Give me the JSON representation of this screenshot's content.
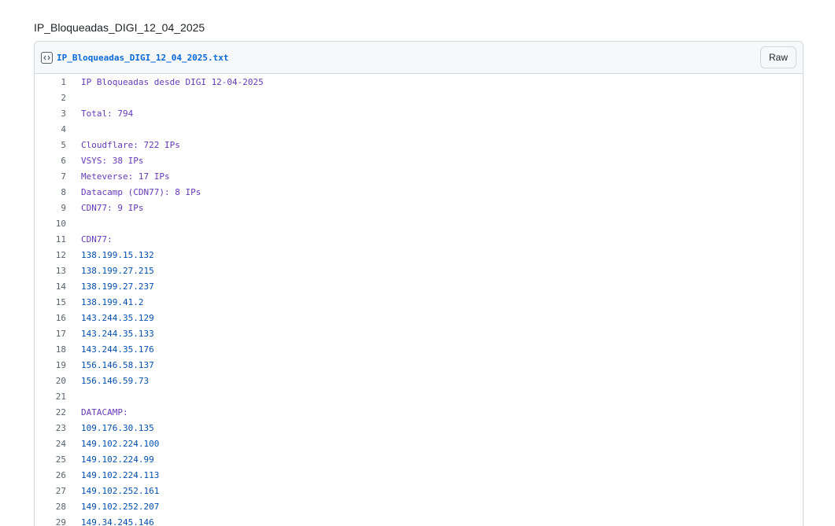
{
  "gist": {
    "title": "IP_Bloqueadas_DIGI_12_04_2025"
  },
  "file": {
    "name": "IP_Bloqueadas_DIGI_12_04_2025.txt",
    "icon": "code-square-icon",
    "raw_label": "Raw"
  },
  "colors": {
    "link": "#0969da",
    "text_line": "#6639ba",
    "ip_line": "#0550ae",
    "line_number": "#59636e",
    "border": "#d0d7de"
  },
  "lines": [
    {
      "n": "1",
      "text": "IP Bloqueadas desde DIGI 12-04-2025",
      "kind": "text"
    },
    {
      "n": "2",
      "text": "",
      "kind": "text"
    },
    {
      "n": "3",
      "text": "Total: 794",
      "kind": "text"
    },
    {
      "n": "4",
      "text": "",
      "kind": "text"
    },
    {
      "n": "5",
      "text": "Cloudflare: 722 IPs",
      "kind": "text"
    },
    {
      "n": "6",
      "text": "VSYS: 38 IPs",
      "kind": "text"
    },
    {
      "n": "7",
      "text": "Meteverse: 17 IPs",
      "kind": "text"
    },
    {
      "n": "8",
      "text": "Datacamp (CDN77): 8 IPs",
      "kind": "text"
    },
    {
      "n": "9",
      "text": "CDN77: 9 IPs",
      "kind": "text"
    },
    {
      "n": "10",
      "text": "",
      "kind": "text"
    },
    {
      "n": "11",
      "text": "CDN77:",
      "kind": "text"
    },
    {
      "n": "12",
      "text": "138.199.15.132",
      "kind": "ip"
    },
    {
      "n": "13",
      "text": "138.199.27.215",
      "kind": "ip"
    },
    {
      "n": "14",
      "text": "138.199.27.237",
      "kind": "ip"
    },
    {
      "n": "15",
      "text": "138.199.41.2",
      "kind": "ip"
    },
    {
      "n": "16",
      "text": "143.244.35.129",
      "kind": "ip"
    },
    {
      "n": "17",
      "text": "143.244.35.133",
      "kind": "ip"
    },
    {
      "n": "18",
      "text": "143.244.35.176",
      "kind": "ip"
    },
    {
      "n": "19",
      "text": "156.146.58.137",
      "kind": "ip"
    },
    {
      "n": "20",
      "text": "156.146.59.73",
      "kind": "ip"
    },
    {
      "n": "21",
      "text": "",
      "kind": "text"
    },
    {
      "n": "22",
      "text": "DATACAMP:",
      "kind": "text"
    },
    {
      "n": "23",
      "text": "109.176.30.135",
      "kind": "ip"
    },
    {
      "n": "24",
      "text": "149.102.224.100",
      "kind": "ip"
    },
    {
      "n": "25",
      "text": "149.102.224.99",
      "kind": "ip"
    },
    {
      "n": "26",
      "text": "149.102.224.113",
      "kind": "ip"
    },
    {
      "n": "27",
      "text": "149.102.252.161",
      "kind": "ip"
    },
    {
      "n": "28",
      "text": "149.102.252.207",
      "kind": "ip"
    },
    {
      "n": "29",
      "text": "149.34.245.146",
      "kind": "ip"
    }
  ]
}
